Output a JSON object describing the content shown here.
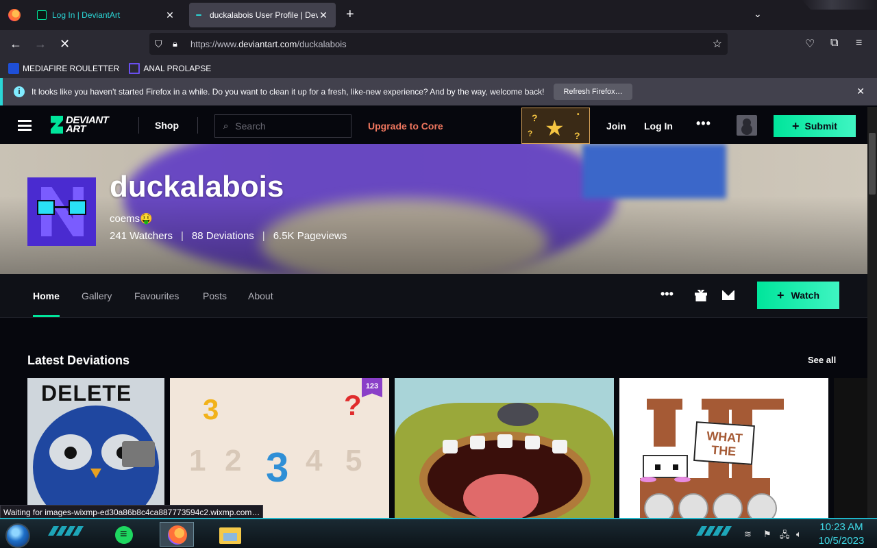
{
  "browser": {
    "tabs": [
      {
        "label": "Log In | DeviantArt",
        "active": false
      },
      {
        "label": "duckalabois User Profile | Devia",
        "active": true
      }
    ],
    "new_tab": "+",
    "tab_list": "⌄",
    "url_prefix": "https://www.",
    "url_domain": "deviantart.com",
    "url_path": "/duckalabois",
    "bookmarks": [
      {
        "label": "MEDIAFIRE ROULETTER",
        "icon": "mediafire-icon"
      },
      {
        "label": "ANAL PROLAPSE",
        "icon": "bookmark-triangle-icon"
      }
    ],
    "notice": {
      "message": "It looks like you haven't started Firefox in a while. Do you want to clean it up for a fresh, like-new experience? And by the way, welcome back!",
      "button": "Refresh Firefox…",
      "info_glyph": "i",
      "close": "✕"
    }
  },
  "site": {
    "logo_line1": "DEVIANT",
    "logo_line2": "ART",
    "shop": "Shop",
    "search_placeholder": "Search",
    "upgrade": "Upgrade to Core",
    "join": "Join",
    "login": "Log In",
    "more": "•••",
    "submit": "Submit",
    "submit_plus": "+"
  },
  "profile": {
    "username": "duckalabois",
    "tagline": "coems🤑",
    "watchers": "241 Watchers",
    "deviations": "88 Deviations",
    "pageviews": "6.5K Pageviews",
    "stat_sep": "|",
    "tabs": [
      "Home",
      "Gallery",
      "Favourites",
      "Posts",
      "About"
    ],
    "more": "•••",
    "watch": "Watch",
    "watch_plus": "+"
  },
  "content": {
    "section_title": "Latest Deviations",
    "see_all": "See all",
    "thumb1_text": "DELETE",
    "thumb2_badge": "123",
    "thumb2_digits": [
      "1",
      "2",
      "3",
      "4",
      "5"
    ],
    "thumb2_question": "?",
    "thumb4_speech": "WHAT THE"
  },
  "status_text": "Waiting for images-wixmp-ed30a86b8c4ca887773594c2.wixmp.com…",
  "taskbar": {
    "time": "10:23 AM",
    "date": "10/5/2023"
  },
  "colors": {
    "accent_green": "#00e59b",
    "upgrade_orange": "#f0775f",
    "firefox_teal": "#2bd6d6",
    "clock_cyan": "#3fd9e6"
  }
}
